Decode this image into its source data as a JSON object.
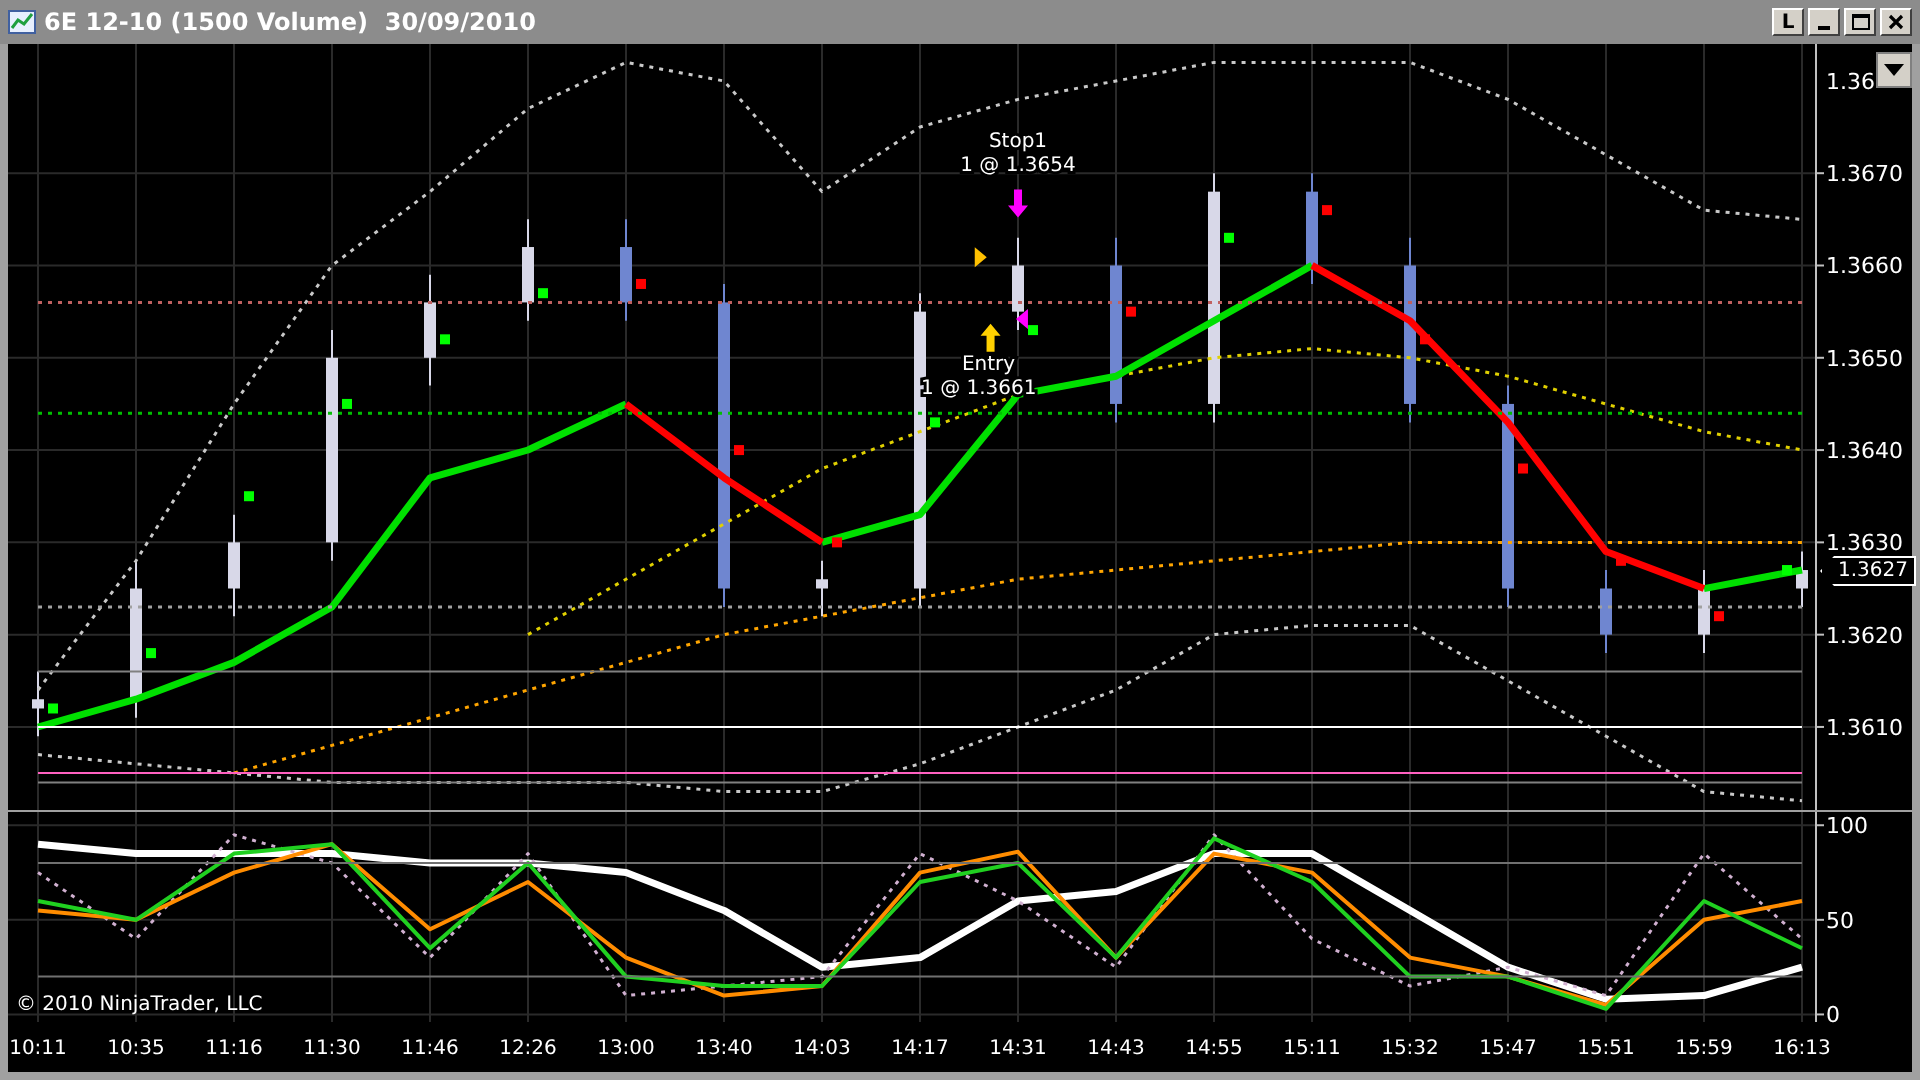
{
  "window": {
    "title": "6E 12-10 (1500 Volume)  30/09/2010",
    "buttons": [
      {
        "kind": "text",
        "label": "L"
      },
      {
        "kind": "minimize"
      },
      {
        "kind": "maximize"
      },
      {
        "kind": "close"
      }
    ]
  },
  "price_panel": {
    "current_price": "1.3627",
    "top_axis_label": "1.36",
    "chart_data": {
      "type": "candlestick",
      "grid": true,
      "ylim": [
        1.3601,
        1.3684
      ],
      "yticks": [
        {
          "value": 1.367,
          "label": "1.3670"
        },
        {
          "value": 1.366,
          "label": "1.3660"
        },
        {
          "value": 1.365,
          "label": "1.3650"
        },
        {
          "value": 1.364,
          "label": "1.3640"
        },
        {
          "value": 1.363,
          "label": "1.3630"
        },
        {
          "value": 1.362,
          "label": "1.3620"
        },
        {
          "value": 1.361,
          "label": "1.3610"
        }
      ],
      "ohlc": [
        [
          1.3612,
          1.3616,
          1.3609,
          1.3613
        ],
        [
          1.3613,
          1.3628,
          1.3611,
          1.3625
        ],
        [
          1.3625,
          1.3633,
          1.3622,
          1.363
        ],
        [
          1.363,
          1.3653,
          1.3628,
          1.365
        ],
        [
          1.365,
          1.3659,
          1.3647,
          1.3656
        ],
        [
          1.3656,
          1.3665,
          1.3654,
          1.3662
        ],
        [
          1.3662,
          1.3665,
          1.3654,
          1.3656
        ],
        [
          1.3656,
          1.3658,
          1.3623,
          1.3625
        ],
        [
          1.3625,
          1.3628,
          1.3622,
          1.3626
        ],
        [
          1.3625,
          1.3657,
          1.3623,
          1.3655
        ],
        [
          1.3655,
          1.3663,
          1.3653,
          1.366
        ],
        [
          1.366,
          1.3663,
          1.3643,
          1.3645
        ],
        [
          1.3645,
          1.367,
          1.3643,
          1.3668
        ],
        [
          1.3668,
          1.367,
          1.3658,
          1.366
        ],
        [
          1.366,
          1.3663,
          1.3643,
          1.3645
        ],
        [
          1.3645,
          1.3647,
          1.3623,
          1.3625
        ],
        [
          1.3625,
          1.3627,
          1.3618,
          1.362
        ],
        [
          1.362,
          1.3627,
          1.3618,
          1.3625
        ],
        [
          1.3625,
          1.3629,
          1.3623,
          1.3627
        ]
      ],
      "series": [
        {
          "type": "line",
          "line_style": "dotted",
          "color": "#c8c8c8",
          "values": [
            1.3614,
            1.3628,
            1.3645,
            1.366,
            1.3668,
            1.3677,
            1.3682,
            1.368,
            1.3668,
            1.3675,
            1.3678,
            1.368,
            1.3682,
            1.3682,
            1.3682,
            1.3678,
            1.3672,
            1.3666,
            1.3665
          ]
        },
        {
          "type": "line",
          "line_style": "dotted",
          "color": "#c8c8c8",
          "values": [
            1.3607,
            1.3606,
            1.3605,
            1.3604,
            1.3604,
            1.3604,
            1.3604,
            1.3603,
            1.3603,
            1.3606,
            1.361,
            1.3614,
            1.362,
            1.3621,
            1.3621,
            1.3615,
            1.3609,
            1.3603,
            1.3602
          ]
        },
        {
          "type": "line",
          "line_style": "dotted",
          "color": "#ffa500",
          "values": [
            null,
            null,
            1.3605,
            1.3608,
            1.3611,
            1.3614,
            1.3617,
            1.362,
            1.3622,
            1.3624,
            1.3626,
            1.3627,
            1.3628,
            1.3629,
            1.363,
            1.363,
            1.363,
            1.363,
            1.363
          ]
        },
        {
          "type": "line",
          "line_style": "dotted",
          "color": "#e0d000",
          "values": [
            null,
            null,
            null,
            null,
            null,
            1.362,
            1.3626,
            1.3632,
            1.3638,
            1.3642,
            1.3646,
            1.3648,
            1.365,
            1.3651,
            1.365,
            1.3648,
            1.3645,
            1.3642,
            1.364
          ]
        },
        {
          "type": "line",
          "line_style": "solid",
          "color": "#00e000",
          "values": [
            1.361,
            1.3613,
            1.3617,
            1.3623,
            1.3637,
            1.364,
            1.3645,
            null,
            1.363,
            1.3633,
            1.3646,
            1.3648,
            1.3654,
            1.366,
            null,
            null,
            null,
            1.3625,
            1.3627
          ]
        },
        {
          "type": "line",
          "line_style": "solid",
          "color": "#ff0000",
          "values": [
            null,
            null,
            null,
            null,
            null,
            null,
            1.3645,
            1.3637,
            1.363,
            null,
            null,
            null,
            null,
            1.366,
            1.3654,
            1.3643,
            1.3629,
            1.3625,
            null
          ]
        },
        {
          "type": "scatter",
          "color": "#00ff00",
          "values": [
            1.3612,
            1.3618,
            1.3635,
            1.3645,
            1.3652,
            1.3657,
            null,
            null,
            null,
            1.3643,
            1.3653,
            null,
            1.3663,
            null,
            null,
            null,
            null,
            null,
            1.3627
          ]
        },
        {
          "type": "scatter",
          "color": "#ff0000",
          "values": [
            null,
            null,
            null,
            null,
            null,
            null,
            1.3658,
            1.364,
            1.363,
            null,
            null,
            1.3655,
            null,
            1.3666,
            1.3652,
            1.3638,
            1.3628,
            1.3622,
            null
          ]
        },
        {
          "type": "line",
          "line_style": "dotted",
          "color": "#00c000",
          "values": [
            1.3644,
            1.3644,
            1.3644,
            1.3644,
            1.3644,
            1.3644,
            1.3644,
            1.3644,
            1.3644,
            1.3644,
            1.3644,
            1.3644,
            1.3644,
            1.3644,
            1.3644,
            1.3644,
            1.3644,
            1.3644,
            1.3644
          ]
        },
        {
          "type": "line",
          "line_style": "dotted",
          "color": "#c06060",
          "values": [
            1.3656,
            1.3656,
            1.3656,
            1.3656,
            1.3656,
            1.3656,
            1.3656,
            1.3656,
            1.3656,
            1.3656,
            1.3656,
            1.3656,
            1.3656,
            1.3656,
            1.3656,
            1.3656,
            1.3656,
            1.3656,
            1.3656
          ]
        },
        {
          "type": "line",
          "line_style": "dotted",
          "color": "#a0a0a0",
          "values": [
            1.3623,
            1.3623,
            1.3623,
            1.3623,
            1.3623,
            1.3623,
            1.3623,
            1.3623,
            1.3623,
            1.3623,
            1.3623,
            1.3623,
            1.3623,
            1.3623,
            1.3623,
            1.3623,
            1.3623,
            1.3623,
            1.3623
          ]
        },
        {
          "type": "line",
          "line_style": "solid",
          "color": "#808080",
          "values": [
            1.3616,
            1.3616,
            1.3616,
            1.3616,
            1.3616,
            1.3616,
            1.3616,
            1.3616,
            1.3616,
            1.3616,
            1.3616,
            1.3616,
            1.3616,
            1.3616,
            1.3616,
            1.3616,
            1.3616,
            1.3616,
            1.3616
          ]
        },
        {
          "type": "line",
          "line_style": "solid",
          "color": "#ffffff",
          "values": [
            1.361,
            1.361,
            1.361,
            1.361,
            1.361,
            1.361,
            1.361,
            1.361,
            1.361,
            1.361,
            1.361,
            1.361,
            1.361,
            1.361,
            1.361,
            1.361,
            1.361,
            1.361,
            1.361
          ]
        },
        {
          "type": "line",
          "line_style": "solid",
          "color": "#ff60c0",
          "values": [
            1.3605,
            1.3605,
            1.3605,
            1.3605,
            1.3605,
            1.3605,
            1.3605,
            1.3605,
            1.3605,
            1.3605,
            1.3605,
            1.3605,
            1.3605,
            1.3605,
            1.3605,
            1.3605,
            1.3605,
            1.3605,
            1.3605
          ]
        },
        {
          "type": "line",
          "line_style": "solid",
          "color": "#808080",
          "values": [
            1.3604,
            1.3604,
            1.3604,
            1.3604,
            1.3604,
            1.3604,
            1.3604,
            1.3604,
            1.3604,
            1.3604,
            1.3604,
            1.3604,
            1.3604,
            1.3604,
            1.3604,
            1.3604,
            1.3604,
            1.3604,
            1.3604
          ]
        }
      ],
      "annotations": [
        "Stop1",
        "1 @ 1.3654",
        "Entry",
        "1 @ 1.3661"
      ]
    }
  },
  "indicator_panel": {
    "copyright": "© 2010 NinjaTrader, LLC",
    "chart_data": {
      "type": "line",
      "grid": true,
      "categories": [
        "10:11",
        "10:35",
        "11:16",
        "11:30",
        "11:46",
        "12:26",
        "13:00",
        "13:40",
        "14:03",
        "14:17",
        "14:31",
        "14:43",
        "14:55",
        "15:11",
        "15:32",
        "15:47",
        "15:51",
        "15:59",
        "16:13"
      ],
      "ylim": [
        -4,
        107
      ],
      "yticks": [
        {
          "value": 0,
          "label": "0"
        },
        {
          "value": 50,
          "label": "50"
        },
        {
          "value": 100,
          "label": "100"
        }
      ],
      "series": [
        {
          "line_style": "solid",
          "color": "#ffffff",
          "values": [
            90,
            85,
            85,
            85,
            80,
            80,
            75,
            55,
            25,
            30,
            60,
            65,
            85,
            85,
            55,
            25,
            8,
            10,
            25
          ]
        },
        {
          "line_style": "dotted",
          "color": "#d0b0d0",
          "values": [
            75,
            40,
            95,
            80,
            30,
            85,
            10,
            15,
            20,
            85,
            60,
            25,
            95,
            40,
            15,
            25,
            10,
            85,
            40
          ]
        },
        {
          "line_style": "solid",
          "color": "#ff8c00",
          "values": [
            55,
            50,
            75,
            90,
            45,
            70,
            30,
            10,
            15,
            75,
            86,
            30,
            85,
            75,
            30,
            20,
            5,
            50,
            60
          ]
        },
        {
          "line_style": "solid",
          "color": "#20d020",
          "values": [
            60,
            50,
            85,
            90,
            35,
            80,
            20,
            15,
            15,
            70,
            80,
            30,
            93,
            70,
            20,
            20,
            3,
            60,
            35
          ]
        },
        {
          "line_style": "solid",
          "color": "#707070",
          "values": [
            80,
            80,
            80,
            80,
            80,
            80,
            80,
            80,
            80,
            80,
            80,
            80,
            80,
            80,
            80,
            80,
            80,
            80,
            80
          ]
        },
        {
          "line_style": "solid",
          "color": "#707070",
          "values": [
            20,
            20,
            20,
            20,
            20,
            20,
            20,
            20,
            20,
            20,
            20,
            20,
            20,
            20,
            20,
            20,
            20,
            20,
            20
          ]
        }
      ]
    }
  }
}
